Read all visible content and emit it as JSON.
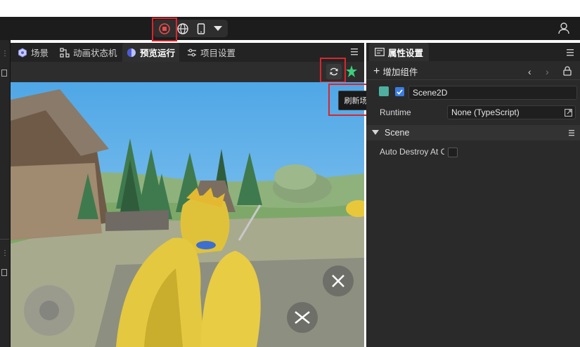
{
  "toolbar": {
    "stop_icon": "stop-record-icon",
    "globe_icon": "globe-icon",
    "device_icon": "phone-icon",
    "dropdown_icon": "chevron-down-icon",
    "user_icon": "user-icon"
  },
  "center": {
    "tabs": [
      {
        "label": "场景",
        "icon": "scene-icon"
      },
      {
        "label": "动画状态机",
        "icon": "state-machine-icon"
      },
      {
        "label": "预览运行",
        "icon": "preview-icon"
      },
      {
        "label": "项目设置",
        "icon": "settings-icon"
      }
    ],
    "active_tab": "预览运行",
    "refresh_tooltip": "刷新场景"
  },
  "inspector": {
    "tab_label": "属性设置",
    "add_component_label": "增加组件",
    "node_name": "Scene2D",
    "runtime_label": "Runtime",
    "runtime_value": "None (TypeScript)",
    "section_title": "Scene",
    "auto_destroy_label": "Auto Destroy At C"
  },
  "colors": {
    "highlight": "#d9262c",
    "accent_green": "#3ccf7c",
    "checkbox_blue": "#3b7de0"
  }
}
